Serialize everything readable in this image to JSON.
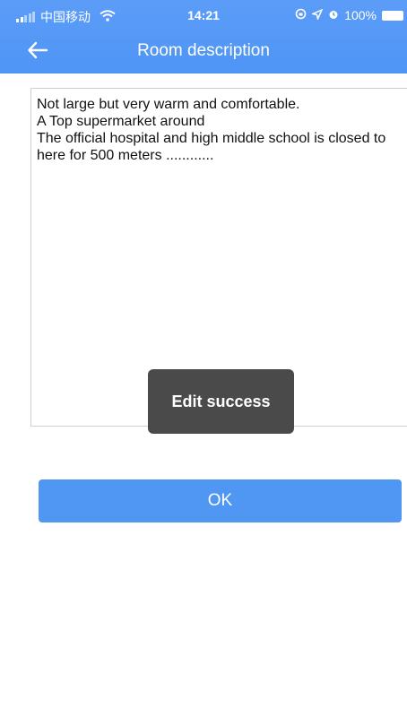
{
  "status_bar": {
    "carrier": "中国移动",
    "time": "14:21",
    "battery": "100%"
  },
  "nav": {
    "title": "Room description"
  },
  "description": {
    "value": "Not large but very warm and comfortable.\nA Top supermarket around\nThe official hospital and high middle school is closed to here for 500 meters ............"
  },
  "toast": {
    "message": "Edit success"
  },
  "actions": {
    "ok_label": "OK"
  },
  "colors": {
    "accent": "#4f95f6",
    "toast_bg": "#4a4a4a"
  }
}
